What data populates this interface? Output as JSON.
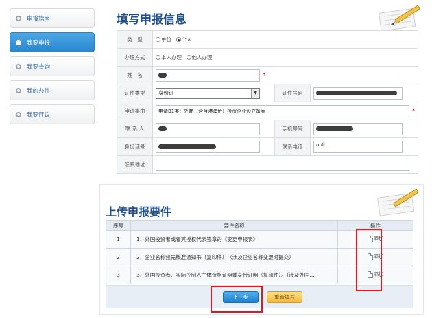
{
  "sidebar": {
    "items": [
      {
        "label": "申报指南",
        "active": false
      },
      {
        "label": "我要申报",
        "active": true
      },
      {
        "label": "我要查询",
        "active": false
      },
      {
        "label": "我的办件",
        "active": false
      },
      {
        "label": "我要评议",
        "active": false
      }
    ]
  },
  "form": {
    "title": "填写申报信息",
    "type_label": "类　型",
    "type_options": [
      "单位",
      "个人"
    ],
    "handling_label": "办理方式",
    "handling_options": [
      "本人办理",
      "他人办理"
    ],
    "name_label": "姓　名",
    "cert_type_label": "证件类型",
    "cert_type_value": "身份证",
    "cert_no_label": "证件号码",
    "reason_label": "申请事由",
    "reason_value": "申请B1类：外商（含台港澳侨）投资企业设立备案",
    "contact_label": "联 系 人",
    "mobile_label": "手机号码",
    "id_label": "身份证号",
    "phone_label": "联系电话",
    "phone_value": "null",
    "address_label": "联系地址",
    "required_mark": "*"
  },
  "upload": {
    "title": "上传申报要件",
    "headers": [
      "序号",
      "要件名称",
      "操作"
    ],
    "rows": [
      {
        "no": "1",
        "name": "1、外国投资者或者其授权代表签章的《变更申报表》",
        "action": "添加"
      },
      {
        "no": "2",
        "name": "2、企业名称预先核准通知书（复印件）：（涉及企业名称变更时提交）",
        "action": "添加"
      },
      {
        "no": "3",
        "name": "3、外国投资者、实际控制人主体资格证明或身份证明（复印件）。（涉及外国…",
        "action": "添加"
      }
    ],
    "next_button": "下一步",
    "reset_button": "重新填写"
  }
}
